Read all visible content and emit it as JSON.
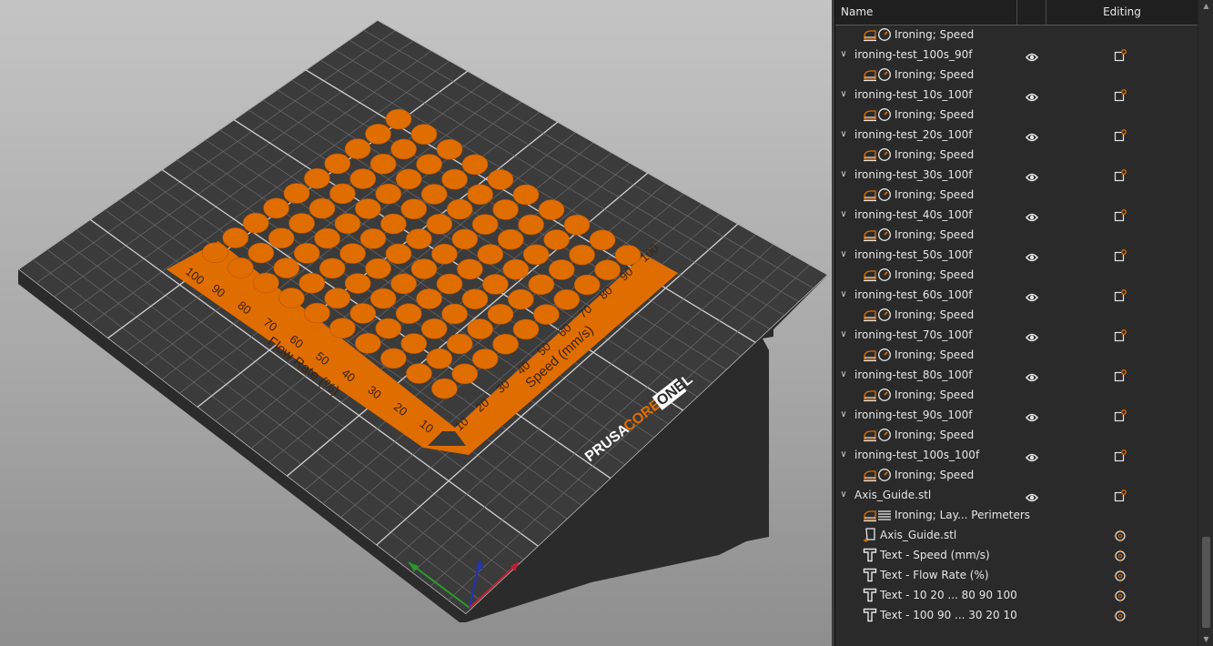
{
  "panel": {
    "columns": {
      "name": "Name",
      "editing": "Editing"
    },
    "rows": [
      {
        "type": "setting",
        "label": "Ironing; Speed"
      },
      {
        "type": "object",
        "label": "ironing-test_100s_90f"
      },
      {
        "type": "setting",
        "label": "Ironing; Speed"
      },
      {
        "type": "object",
        "label": "ironing-test_10s_100f"
      },
      {
        "type": "setting",
        "label": "Ironing; Speed"
      },
      {
        "type": "object",
        "label": "ironing-test_20s_100f"
      },
      {
        "type": "setting",
        "label": "Ironing; Speed"
      },
      {
        "type": "object",
        "label": "ironing-test_30s_100f"
      },
      {
        "type": "setting",
        "label": "Ironing; Speed"
      },
      {
        "type": "object",
        "label": "ironing-test_40s_100f"
      },
      {
        "type": "setting",
        "label": "Ironing; Speed"
      },
      {
        "type": "object",
        "label": "ironing-test_50s_100f"
      },
      {
        "type": "setting",
        "label": "Ironing; Speed"
      },
      {
        "type": "object",
        "label": "ironing-test_60s_100f"
      },
      {
        "type": "setting",
        "label": "Ironing; Speed"
      },
      {
        "type": "object",
        "label": "ironing-test_70s_100f"
      },
      {
        "type": "setting",
        "label": "Ironing; Speed"
      },
      {
        "type": "object",
        "label": "ironing-test_80s_100f"
      },
      {
        "type": "setting",
        "label": "Ironing; Speed"
      },
      {
        "type": "object",
        "label": "ironing-test_90s_100f"
      },
      {
        "type": "setting",
        "label": "Ironing; Speed"
      },
      {
        "type": "object",
        "label": "ironing-test_100s_100f"
      },
      {
        "type": "setting",
        "label": "Ironing; Speed"
      },
      {
        "type": "object",
        "label": "Axis_Guide.stl"
      },
      {
        "type": "setting2",
        "label": "Ironing; Lay... Perimeters"
      },
      {
        "type": "part",
        "label": "Axis_Guide.stl"
      },
      {
        "type": "text",
        "label": "Text - Speed (mm/s)"
      },
      {
        "type": "text",
        "label": "Text - Flow Rate (%)"
      },
      {
        "type": "text",
        "label": "Text - 10  20  ...  80  90  100"
      },
      {
        "type": "text",
        "label": "Text - 100  90  ...  30  20  10"
      }
    ]
  },
  "viewport": {
    "bed_brand": {
      "prusa": "PRUSA",
      "core": "CORE",
      "one": "ONE",
      "l": "L"
    },
    "flow_label": "Flow Rate (%)",
    "speed_label": "Speed (mm/s)",
    "flow_ticks": [
      "100",
      "90",
      "80",
      "70",
      "60",
      "50",
      "40",
      "30",
      "20",
      "10"
    ],
    "speed_ticks": [
      "10",
      "20",
      "30",
      "40",
      "50",
      "60",
      "70",
      "80",
      "90",
      "100"
    ]
  },
  "colors": {
    "accent": "#e06d00",
    "bed": "#333333",
    "panel_bg": "#2a2a2a"
  },
  "icons": {
    "visibility": "eye-icon",
    "edit": "edit-settings-icon",
    "settings": "gear-icon",
    "ironing": "ironing-icon",
    "speed": "speedometer-icon",
    "part": "part-icon",
    "text": "text-icon"
  }
}
